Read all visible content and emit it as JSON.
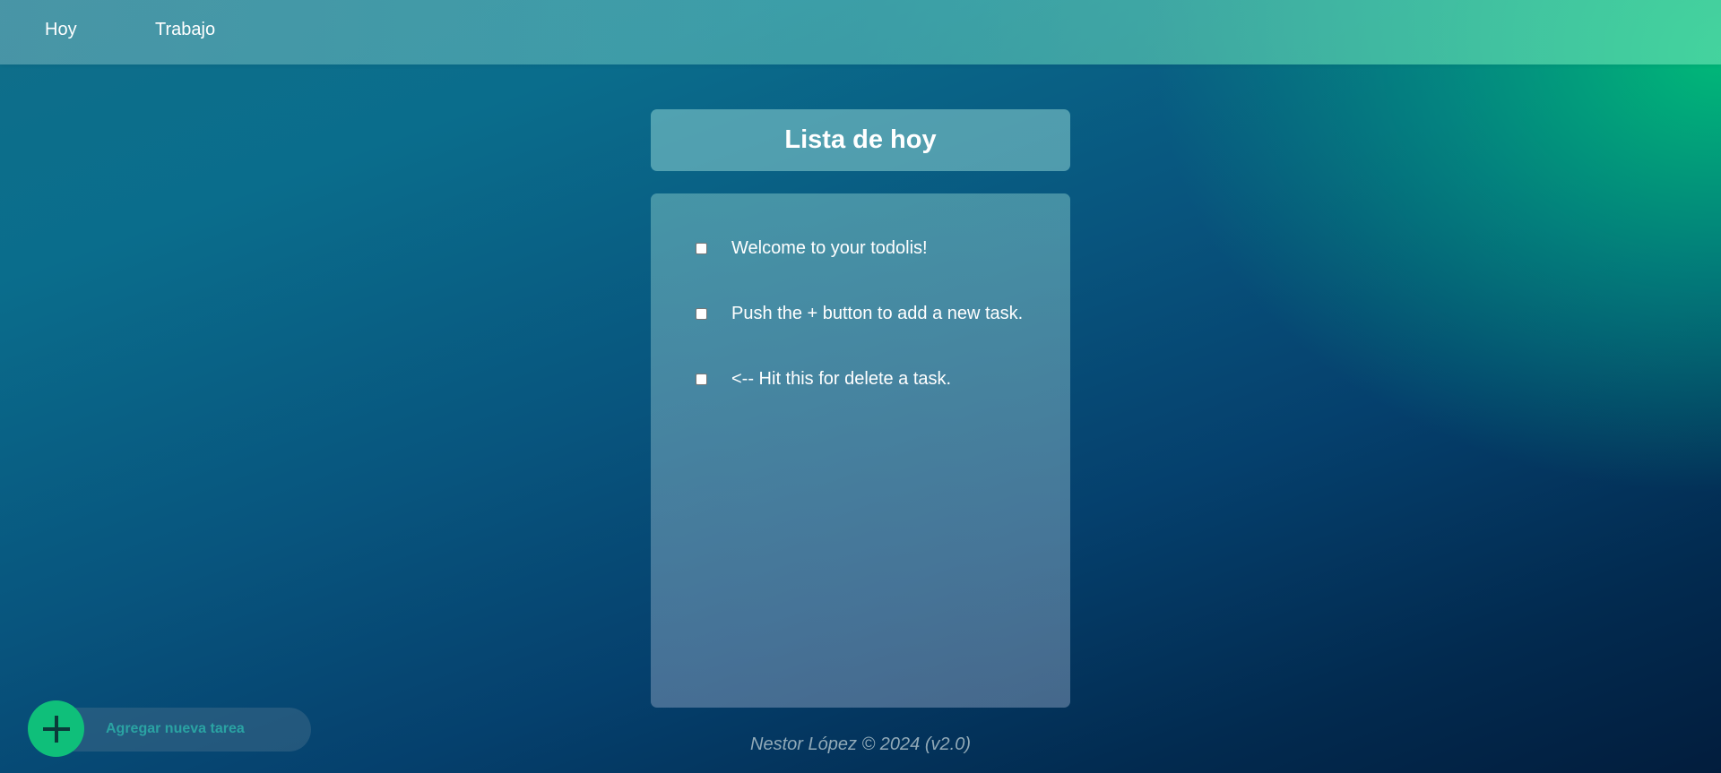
{
  "nav": {
    "items": [
      {
        "label": "Hoy"
      },
      {
        "label": "Trabajo"
      }
    ]
  },
  "list": {
    "title": "Lista de hoy",
    "tasks": [
      {
        "text": "Welcome to your todolis!",
        "checked": false
      },
      {
        "text": "Push the + button to add a new task.",
        "checked": false
      },
      {
        "text": "<-- Hit this for delete a task.",
        "checked": false
      }
    ]
  },
  "add_task": {
    "placeholder": "Agregar nueva tarea",
    "button_icon": "plus-icon"
  },
  "footer": {
    "text": "Nestor López © 2024 (v2.0)"
  },
  "colors": {
    "accent": "#0fbf7a",
    "placeholder": "#2aa3a3"
  }
}
